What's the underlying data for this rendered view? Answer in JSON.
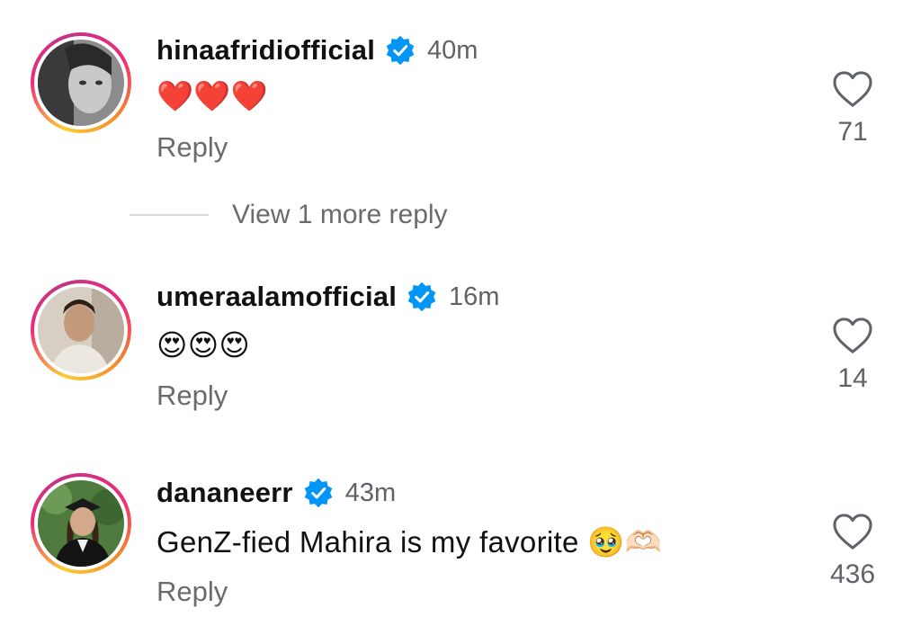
{
  "comments": [
    {
      "username": "hinaafridiofficial",
      "time": "40m",
      "text": "❤️❤️❤️",
      "reply_label": "Reply",
      "likes": "71"
    },
    {
      "username": "umeraalamofficial",
      "time": "16m",
      "text": "😍😍😍",
      "reply_label": "Reply",
      "likes": "14"
    },
    {
      "username": "dananeerr",
      "time": "43m",
      "text": "GenZ-fied Mahira is my favorite 🥹🫶🏻",
      "reply_label": "Reply",
      "likes": "436"
    }
  ],
  "view_more_replies": "View 1 more reply",
  "colors": {
    "verified_badge": "#0095f6",
    "secondary_text": "#6b6b6b",
    "heart_outline": "#5f6368"
  },
  "icons": {
    "like": "heart-outline-icon",
    "verified": "verified-badge-icon"
  }
}
